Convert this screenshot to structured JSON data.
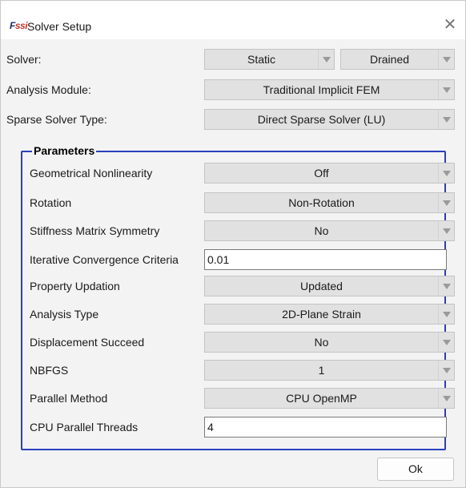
{
  "window": {
    "title": "Solver Setup",
    "icon_name": "fssi-logo-icon",
    "icon_text_a": "F",
    "icon_text_b": "ssi",
    "close_symbol": "✕"
  },
  "top_fields": {
    "solver": {
      "label": "Solver:",
      "value1": "Static",
      "value2": "Drained"
    },
    "analysis_module": {
      "label": "Analysis Module:",
      "value": "Traditional Implicit FEM"
    },
    "sparse_solver": {
      "label": "Sparse Solver Type:",
      "value": "Direct Sparse Solver (LU)"
    }
  },
  "parameters": {
    "title": "Parameters",
    "border_color": "#2a3fbd",
    "fields": [
      {
        "label": "Geometrical Nonlinearity",
        "value": "Off",
        "type": "combo"
      },
      {
        "label": "Rotation",
        "value": "Non-Rotation",
        "type": "combo"
      },
      {
        "label": "Stiffness Matrix Symmetry",
        "value": "No",
        "type": "combo"
      },
      {
        "label": "Iterative Convergence Criteria",
        "value": "0.01",
        "type": "text"
      },
      {
        "label": "Property Updation",
        "value": "Updated",
        "type": "combo"
      },
      {
        "label": "Analysis Type",
        "value": "2D-Plane Strain",
        "type": "combo"
      },
      {
        "label": "Displacement Succeed",
        "value": "No",
        "type": "combo"
      },
      {
        "label": "NBFGS",
        "value": "1",
        "type": "combo"
      },
      {
        "label": "Parallel Method",
        "value": "CPU OpenMP",
        "type": "combo"
      },
      {
        "label": "CPU Parallel Threads",
        "value": "4",
        "type": "text"
      }
    ]
  },
  "buttons": {
    "ok": "Ok"
  }
}
